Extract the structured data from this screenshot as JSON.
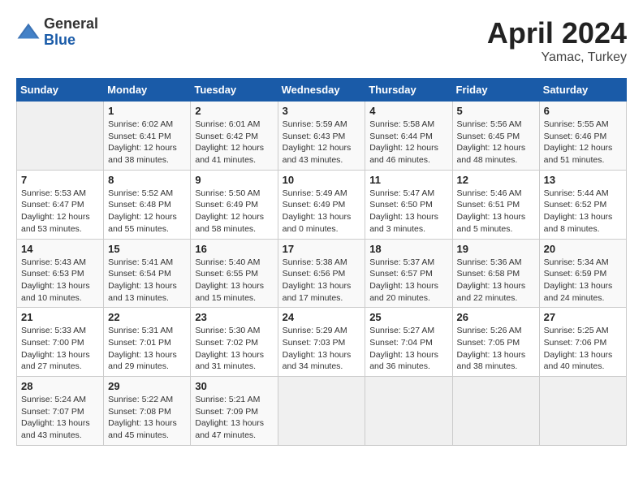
{
  "header": {
    "logo_general": "General",
    "logo_blue": "Blue",
    "month": "April 2024",
    "location": "Yamac, Turkey"
  },
  "days_of_week": [
    "Sunday",
    "Monday",
    "Tuesday",
    "Wednesday",
    "Thursday",
    "Friday",
    "Saturday"
  ],
  "weeks": [
    [
      {
        "day": "",
        "info": ""
      },
      {
        "day": "1",
        "info": "Sunrise: 6:02 AM\nSunset: 6:41 PM\nDaylight: 12 hours\nand 38 minutes."
      },
      {
        "day": "2",
        "info": "Sunrise: 6:01 AM\nSunset: 6:42 PM\nDaylight: 12 hours\nand 41 minutes."
      },
      {
        "day": "3",
        "info": "Sunrise: 5:59 AM\nSunset: 6:43 PM\nDaylight: 12 hours\nand 43 minutes."
      },
      {
        "day": "4",
        "info": "Sunrise: 5:58 AM\nSunset: 6:44 PM\nDaylight: 12 hours\nand 46 minutes."
      },
      {
        "day": "5",
        "info": "Sunrise: 5:56 AM\nSunset: 6:45 PM\nDaylight: 12 hours\nand 48 minutes."
      },
      {
        "day": "6",
        "info": "Sunrise: 5:55 AM\nSunset: 6:46 PM\nDaylight: 12 hours\nand 51 minutes."
      }
    ],
    [
      {
        "day": "7",
        "info": "Sunrise: 5:53 AM\nSunset: 6:47 PM\nDaylight: 12 hours\nand 53 minutes."
      },
      {
        "day": "8",
        "info": "Sunrise: 5:52 AM\nSunset: 6:48 PM\nDaylight: 12 hours\nand 55 minutes."
      },
      {
        "day": "9",
        "info": "Sunrise: 5:50 AM\nSunset: 6:49 PM\nDaylight: 12 hours\nand 58 minutes."
      },
      {
        "day": "10",
        "info": "Sunrise: 5:49 AM\nSunset: 6:49 PM\nDaylight: 13 hours\nand 0 minutes."
      },
      {
        "day": "11",
        "info": "Sunrise: 5:47 AM\nSunset: 6:50 PM\nDaylight: 13 hours\nand 3 minutes."
      },
      {
        "day": "12",
        "info": "Sunrise: 5:46 AM\nSunset: 6:51 PM\nDaylight: 13 hours\nand 5 minutes."
      },
      {
        "day": "13",
        "info": "Sunrise: 5:44 AM\nSunset: 6:52 PM\nDaylight: 13 hours\nand 8 minutes."
      }
    ],
    [
      {
        "day": "14",
        "info": "Sunrise: 5:43 AM\nSunset: 6:53 PM\nDaylight: 13 hours\nand 10 minutes."
      },
      {
        "day": "15",
        "info": "Sunrise: 5:41 AM\nSunset: 6:54 PM\nDaylight: 13 hours\nand 13 minutes."
      },
      {
        "day": "16",
        "info": "Sunrise: 5:40 AM\nSunset: 6:55 PM\nDaylight: 13 hours\nand 15 minutes."
      },
      {
        "day": "17",
        "info": "Sunrise: 5:38 AM\nSunset: 6:56 PM\nDaylight: 13 hours\nand 17 minutes."
      },
      {
        "day": "18",
        "info": "Sunrise: 5:37 AM\nSunset: 6:57 PM\nDaylight: 13 hours\nand 20 minutes."
      },
      {
        "day": "19",
        "info": "Sunrise: 5:36 AM\nSunset: 6:58 PM\nDaylight: 13 hours\nand 22 minutes."
      },
      {
        "day": "20",
        "info": "Sunrise: 5:34 AM\nSunset: 6:59 PM\nDaylight: 13 hours\nand 24 minutes."
      }
    ],
    [
      {
        "day": "21",
        "info": "Sunrise: 5:33 AM\nSunset: 7:00 PM\nDaylight: 13 hours\nand 27 minutes."
      },
      {
        "day": "22",
        "info": "Sunrise: 5:31 AM\nSunset: 7:01 PM\nDaylight: 13 hours\nand 29 minutes."
      },
      {
        "day": "23",
        "info": "Sunrise: 5:30 AM\nSunset: 7:02 PM\nDaylight: 13 hours\nand 31 minutes."
      },
      {
        "day": "24",
        "info": "Sunrise: 5:29 AM\nSunset: 7:03 PM\nDaylight: 13 hours\nand 34 minutes."
      },
      {
        "day": "25",
        "info": "Sunrise: 5:27 AM\nSunset: 7:04 PM\nDaylight: 13 hours\nand 36 minutes."
      },
      {
        "day": "26",
        "info": "Sunrise: 5:26 AM\nSunset: 7:05 PM\nDaylight: 13 hours\nand 38 minutes."
      },
      {
        "day": "27",
        "info": "Sunrise: 5:25 AM\nSunset: 7:06 PM\nDaylight: 13 hours\nand 40 minutes."
      }
    ],
    [
      {
        "day": "28",
        "info": "Sunrise: 5:24 AM\nSunset: 7:07 PM\nDaylight: 13 hours\nand 43 minutes."
      },
      {
        "day": "29",
        "info": "Sunrise: 5:22 AM\nSunset: 7:08 PM\nDaylight: 13 hours\nand 45 minutes."
      },
      {
        "day": "30",
        "info": "Sunrise: 5:21 AM\nSunset: 7:09 PM\nDaylight: 13 hours\nand 47 minutes."
      },
      {
        "day": "",
        "info": ""
      },
      {
        "day": "",
        "info": ""
      },
      {
        "day": "",
        "info": ""
      },
      {
        "day": "",
        "info": ""
      }
    ]
  ]
}
